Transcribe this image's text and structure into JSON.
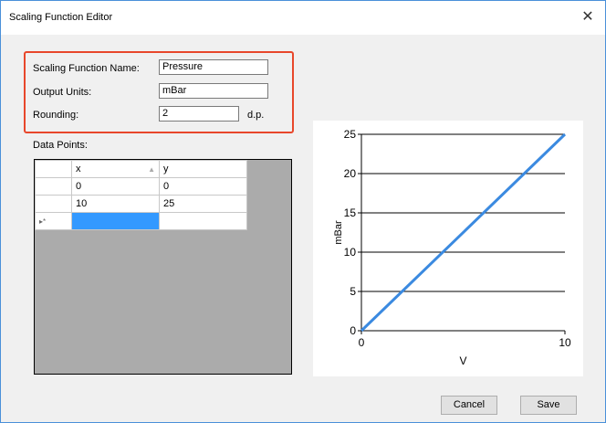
{
  "window": {
    "title": "Scaling Function Editor",
    "close_glyph": "✕"
  },
  "form": {
    "name_label": "Scaling Function Name:",
    "name_value": "Pressure",
    "units_label": "Output Units:",
    "units_value": "mBar",
    "rounding_label": "Rounding:",
    "rounding_value": "2",
    "rounding_suffix": "d.p."
  },
  "data_points": {
    "label": "Data Points:",
    "columns": [
      "x",
      "y"
    ],
    "rows": [
      [
        "0",
        "0"
      ],
      [
        "10",
        "25"
      ]
    ],
    "new_row_marker": "▸*"
  },
  "chart_data": {
    "type": "line",
    "xlabel": "V",
    "ylabel": "mBar",
    "xlim": [
      0,
      10
    ],
    "ylim": [
      0,
      25
    ],
    "x_ticks": [
      "0",
      "10"
    ],
    "y_ticks": [
      "0",
      "5",
      "10",
      "15",
      "20",
      "25"
    ],
    "series": [
      {
        "x": [
          0,
          10
        ],
        "y": [
          0,
          25
        ],
        "color": "#3b8ae0"
      }
    ],
    "grid": true
  },
  "buttons": {
    "cancel": "Cancel",
    "save": "Save"
  },
  "colors": {
    "highlight_border": "#e8472b",
    "selection": "#3399ff",
    "line": "#3b8ae0"
  }
}
